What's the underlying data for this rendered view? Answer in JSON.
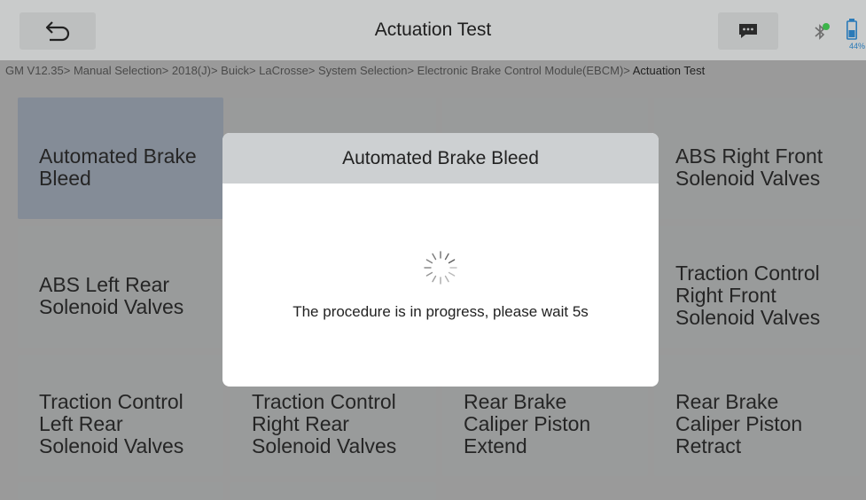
{
  "header": {
    "title": "Actuation Test",
    "battery_percent": "44%"
  },
  "breadcrumb": {
    "path": "GM V12.35> Manual Selection> 2018(J)> Buick> LaCrosse> System Selection> Electronic Brake Control Module(EBCM)> ",
    "current": "Actuation Test"
  },
  "tiles": [
    {
      "label": "Automated Brake Bleed",
      "selected": true
    },
    {
      "label": ""
    },
    {
      "label": ""
    },
    {
      "label": "ABS Right Front Solenoid Valves"
    },
    {
      "label": "ABS Left Rear Solenoid Valves"
    },
    {
      "label": ""
    },
    {
      "label": ""
    },
    {
      "label": "Traction Control Right Front Solenoid Valves"
    },
    {
      "label": "Traction Control Left Rear Solenoid Valves"
    },
    {
      "label": "Traction Control Right Rear Solenoid Valves"
    },
    {
      "label": "Rear Brake Caliper Piston Extend"
    },
    {
      "label": "Rear Brake Caliper Piston Retract"
    },
    {
      "label": ""
    },
    {
      "label": ""
    }
  ],
  "modal": {
    "title": "Automated Brake Bleed",
    "message": "The procedure is in progress, please wait 5s"
  },
  "colors": {
    "accent_blue": "#2a7ab8",
    "bluetooth_green": "#3cb44a"
  }
}
